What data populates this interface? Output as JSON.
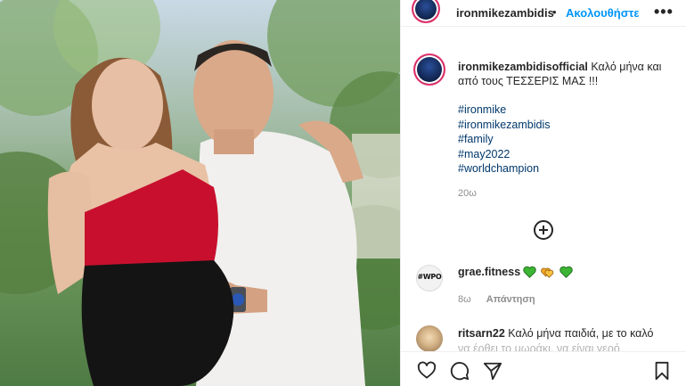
{
  "header": {
    "username": "ironmikezambidis",
    "separator": "•",
    "follow_label": "Ακολουθήστε",
    "more_label": "•••"
  },
  "caption": {
    "username": "ironmikezambidisofficial",
    "text": "Καλό μήνα και από τους ΤΕΣΣΕΡΙΣ ΜΑΣ !!!",
    "hashtags": [
      "#ironmike",
      "#ironmikezambidis",
      "#family",
      "#may2022",
      "#worldchampion"
    ],
    "time": "20ω"
  },
  "comments": [
    {
      "username": "grae.fitness",
      "avatar_text": "#WPO",
      "text": "",
      "emojis": [
        "green-heart",
        "yellow-hearts",
        "green-heart"
      ],
      "time": "8ω",
      "reply_label": "Απάντηση"
    },
    {
      "username": "ritsarn22",
      "text": "Καλό μήνα παιδιά, με το καλό",
      "continuation": "να έρθει το μωράκι, να είναι γερό",
      "time": "",
      "reply_label": ""
    }
  ],
  "colors": {
    "accent": "#0095f6",
    "hashtag": "#00376b",
    "meta": "#8e8e8e",
    "dress_red": "#c8102e"
  },
  "icons": [
    "heart-icon",
    "comment-icon",
    "share-icon",
    "bookmark-icon",
    "add-comment-icon"
  ]
}
